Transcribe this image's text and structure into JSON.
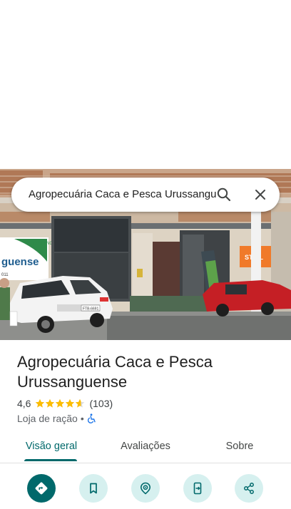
{
  "search": {
    "query": "Agropecuária Caca e Pesca Urussanguense"
  },
  "photo": {
    "sign_left": "guense",
    "sign_left_small": "CAMPING",
    "sign_left_number": "011",
    "sign_right": "STIHL",
    "plate": "FTB-6691"
  },
  "place": {
    "title": "Agropecuária Caca e Pesca Urussanguense",
    "rating": "4,6",
    "stars": 4.6,
    "review_count": "(103)",
    "category": "Loja de ração",
    "separator": "•"
  },
  "tabs": [
    {
      "label": "Visão geral",
      "active": true
    },
    {
      "label": "Avaliações",
      "active": false
    },
    {
      "label": "Sobre",
      "active": false
    }
  ],
  "actions": [
    {
      "icon": "directions-icon"
    },
    {
      "icon": "bookmark-icon"
    },
    {
      "icon": "nearby-icon"
    },
    {
      "icon": "send-to-phone-icon"
    },
    {
      "icon": "share-icon"
    }
  ],
  "colors": {
    "accent": "#00696b",
    "accent_light": "#d6f0ef",
    "star": "#fbbc04",
    "wheelchair": "#1a73e8"
  }
}
